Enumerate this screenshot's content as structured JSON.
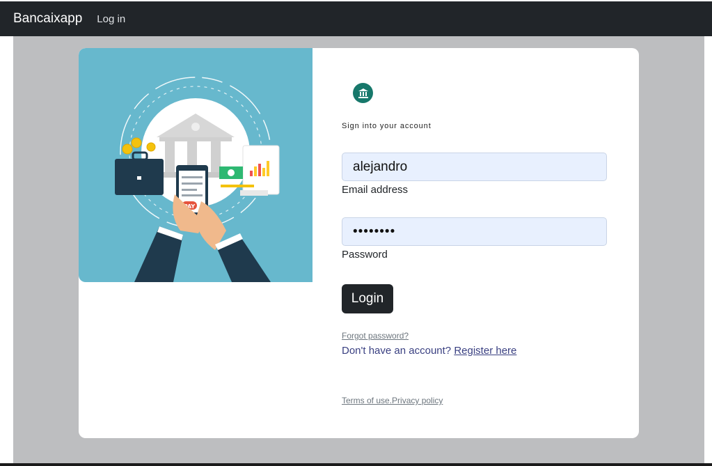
{
  "navbar": {
    "brand": "Bancaixapp",
    "login_link": "Log in"
  },
  "illustration": {
    "pay_label": "PAY"
  },
  "form": {
    "logo_icon": "bank-icon",
    "heading": "Sign into your account",
    "email": {
      "value": "alejandro",
      "label": "Email address"
    },
    "password": {
      "value": "••••••••",
      "label": "Password"
    },
    "login_button": "Login",
    "forgot_link": "Forgot password?",
    "register_prompt": "Don't have an account?",
    "register_link": "Register here",
    "terms_link": "Terms of use.",
    "privacy_link": "Privacy policy"
  },
  "colors": {
    "navbar": "#212529",
    "page_background": "#bdbec0",
    "illustration_background": "#67b8cd",
    "input_background": "#e8f0fe",
    "logo_green": "#17786b",
    "link_blue": "#393f81"
  }
}
